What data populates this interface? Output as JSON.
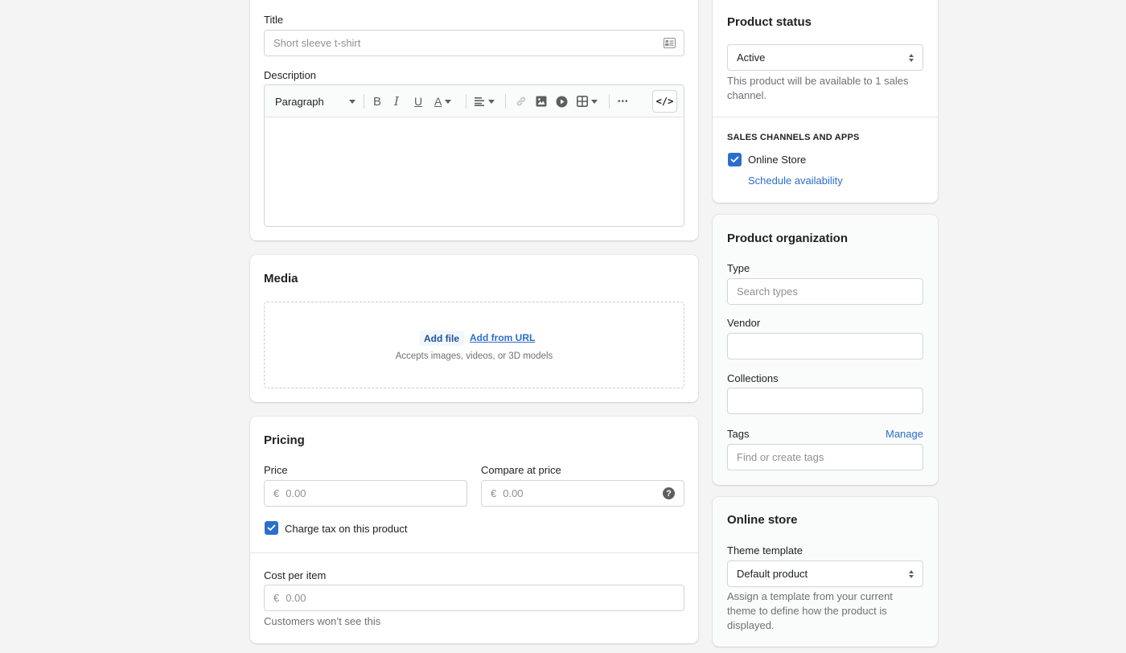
{
  "main": {
    "title_section": {
      "title_label": "Title",
      "title_placeholder": "Short sleeve t-shirt",
      "description_label": "Description",
      "toolbar": {
        "paragraph_select": "Paragraph",
        "bold": "B",
        "italic": "I",
        "underline": "U",
        "text_color": "A",
        "code_view": "</>",
        "more": "•••"
      }
    },
    "media": {
      "heading": "Media",
      "add_file": "Add file",
      "add_from_url": "Add from URL",
      "accepts": "Accepts images, videos, or 3D models"
    },
    "pricing": {
      "heading": "Pricing",
      "price_label": "Price",
      "price_prefix": "€",
      "price_placeholder": "0.00",
      "compare_label": "Compare at price",
      "compare_prefix": "€",
      "compare_placeholder": "0.00",
      "charge_tax_label": "Charge tax on this product",
      "charge_tax_checked": true,
      "cost_label": "Cost per item",
      "cost_prefix": "€",
      "cost_placeholder": "0.00",
      "cost_help": "Customers won’t see this"
    }
  },
  "sidebar": {
    "product_status": {
      "heading": "Product status",
      "status_value": "Active",
      "help": "This product will be available to 1 sales channel.",
      "channels_heading": "SALES CHANNELS AND APPS",
      "channel_online_store": "Online Store",
      "channel_online_store_checked": true,
      "schedule_link": "Schedule availability"
    },
    "organization": {
      "heading": "Product organization",
      "type_label": "Type",
      "type_placeholder": "Search types",
      "vendor_label": "Vendor",
      "vendor_value": "",
      "collections_label": "Collections",
      "collections_value": "",
      "tags_label": "Tags",
      "tags_manage": "Manage",
      "tags_placeholder": "Find or create tags"
    },
    "online_store": {
      "heading": "Online store",
      "theme_label": "Theme template",
      "theme_value": "Default product",
      "help": "Assign a template from your current theme to define how the product is displayed."
    }
  },
  "colors": {
    "accent": "#2c6ecb",
    "background": "#f4f4f4",
    "card": "#ffffff"
  }
}
